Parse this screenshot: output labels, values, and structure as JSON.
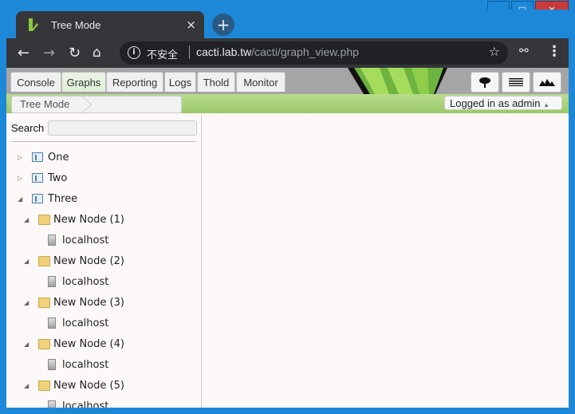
{
  "browser": {
    "tab_title": "Tree Mode",
    "tab_close": "×",
    "new_tab": "+",
    "security_label": "不安全",
    "url_host": "cacti.lab.tw",
    "url_path": "/cacti/graph_view.php",
    "window_controls": [
      "minimize",
      "maximize",
      "close"
    ]
  },
  "cacti": {
    "nav_tabs": [
      {
        "label": "Console",
        "selected": false
      },
      {
        "label": "Graphs",
        "selected": true
      },
      {
        "label": "Reporting",
        "selected": false
      },
      {
        "label": "Logs",
        "selected": false
      },
      {
        "label": "Thold",
        "selected": false
      },
      {
        "label": "Monitor",
        "selected": false
      }
    ],
    "view_buttons": [
      "tree-view-icon",
      "list-view-icon",
      "preview-icon"
    ],
    "breadcrumb": "Tree Mode",
    "logged_in": "Logged in as admin",
    "search_label": "Search"
  },
  "tree": [
    {
      "label": "One",
      "type": "tree",
      "expanded": false
    },
    {
      "label": "Two",
      "type": "tree",
      "expanded": false
    },
    {
      "label": "Three",
      "type": "tree",
      "expanded": true
    },
    {
      "label": "New Node (1)",
      "type": "branch"
    },
    {
      "label": "localhost",
      "type": "host"
    },
    {
      "label": "New Node (2)",
      "type": "branch"
    },
    {
      "label": "localhost",
      "type": "host"
    },
    {
      "label": "New Node (3)",
      "type": "branch"
    },
    {
      "label": "localhost",
      "type": "host"
    },
    {
      "label": "New Node (4)",
      "type": "branch"
    },
    {
      "label": "localhost",
      "type": "host"
    },
    {
      "label": "New Node (5)",
      "type": "branch"
    },
    {
      "label": "localhost",
      "type": "host"
    }
  ],
  "colors": {
    "accent_green": "#9ac868",
    "chrome_dark": "#35363a",
    "window_blue": "#1e88d8"
  }
}
